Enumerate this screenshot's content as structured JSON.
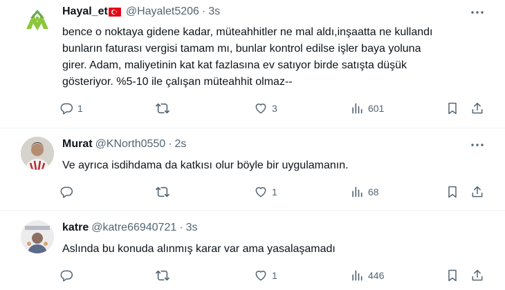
{
  "tweets": [
    {
      "name": "Hayal_et",
      "handle": "@Hayalet5206",
      "dot": "·",
      "time": "3s",
      "text_lines": [
        "bence o noktaya gidene kadar, müteahhitler ne mal aldı,inşaatta ne kullandı",
        "bunların faturası vergisi tamam mı, bunlar kontrol edilse işler baya yoluna",
        "girer. Adam, maliyetinin kat kat fazlasına ev satıyor birde satışta düşük",
        "gösteriyor. %5-10 ile çalışan müteahhit olmaz--"
      ],
      "replies": "1",
      "retweets": "",
      "likes": "3",
      "views": "601"
    },
    {
      "name": "Murat",
      "handle": "@KNorth0550",
      "dot": "·",
      "time": "2s",
      "text_lines": [
        "Ve ayrıca isdihdama da katkısı olur böyle bir uygulamanın."
      ],
      "replies": "",
      "retweets": "",
      "likes": "1",
      "views": "68"
    },
    {
      "name": "katre",
      "handle": "@katre66940721",
      "dot": "·",
      "time": "3s",
      "text_lines": [
        "Aslında bu konuda alınmış karar var ama yasalaşamadı"
      ],
      "replies": "",
      "retweets": "",
      "likes": "1",
      "views": "446"
    }
  ],
  "icons": {
    "flag": "turkish-flag-icon",
    "more": "more-horizontal-icon",
    "reply": "reply-icon",
    "retweet": "retweet-icon",
    "like": "like-heart-icon",
    "views": "views-chart-icon",
    "bookmark": "bookmark-icon",
    "share": "share-icon"
  },
  "colors": {
    "text": "#0f1419",
    "secondary": "#536471",
    "divider": "#eff3f4",
    "flag_red": "#e30a17"
  }
}
